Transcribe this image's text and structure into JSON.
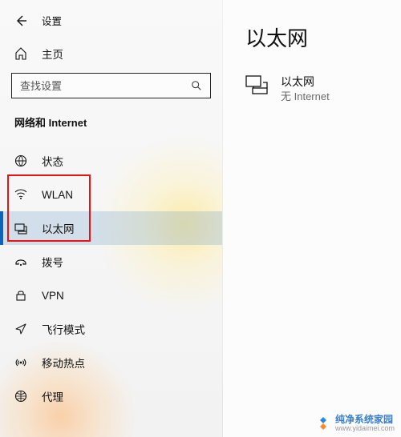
{
  "header": {
    "title": "设置"
  },
  "home": {
    "label": "主页"
  },
  "search": {
    "placeholder": "查找设置"
  },
  "section": {
    "title": "网络和 Internet"
  },
  "nav": {
    "items": [
      {
        "label": "状态"
      },
      {
        "label": "WLAN"
      },
      {
        "label": "以太网"
      },
      {
        "label": "拨号"
      },
      {
        "label": "VPN"
      },
      {
        "label": "飞行模式"
      },
      {
        "label": "移动热点"
      },
      {
        "label": "代理"
      }
    ]
  },
  "main": {
    "title": "以太网",
    "network": {
      "name": "以太网",
      "status": "无 Internet"
    }
  },
  "watermark": {
    "line1": "纯净系统家园",
    "line2": "www.yidaimei.com"
  }
}
